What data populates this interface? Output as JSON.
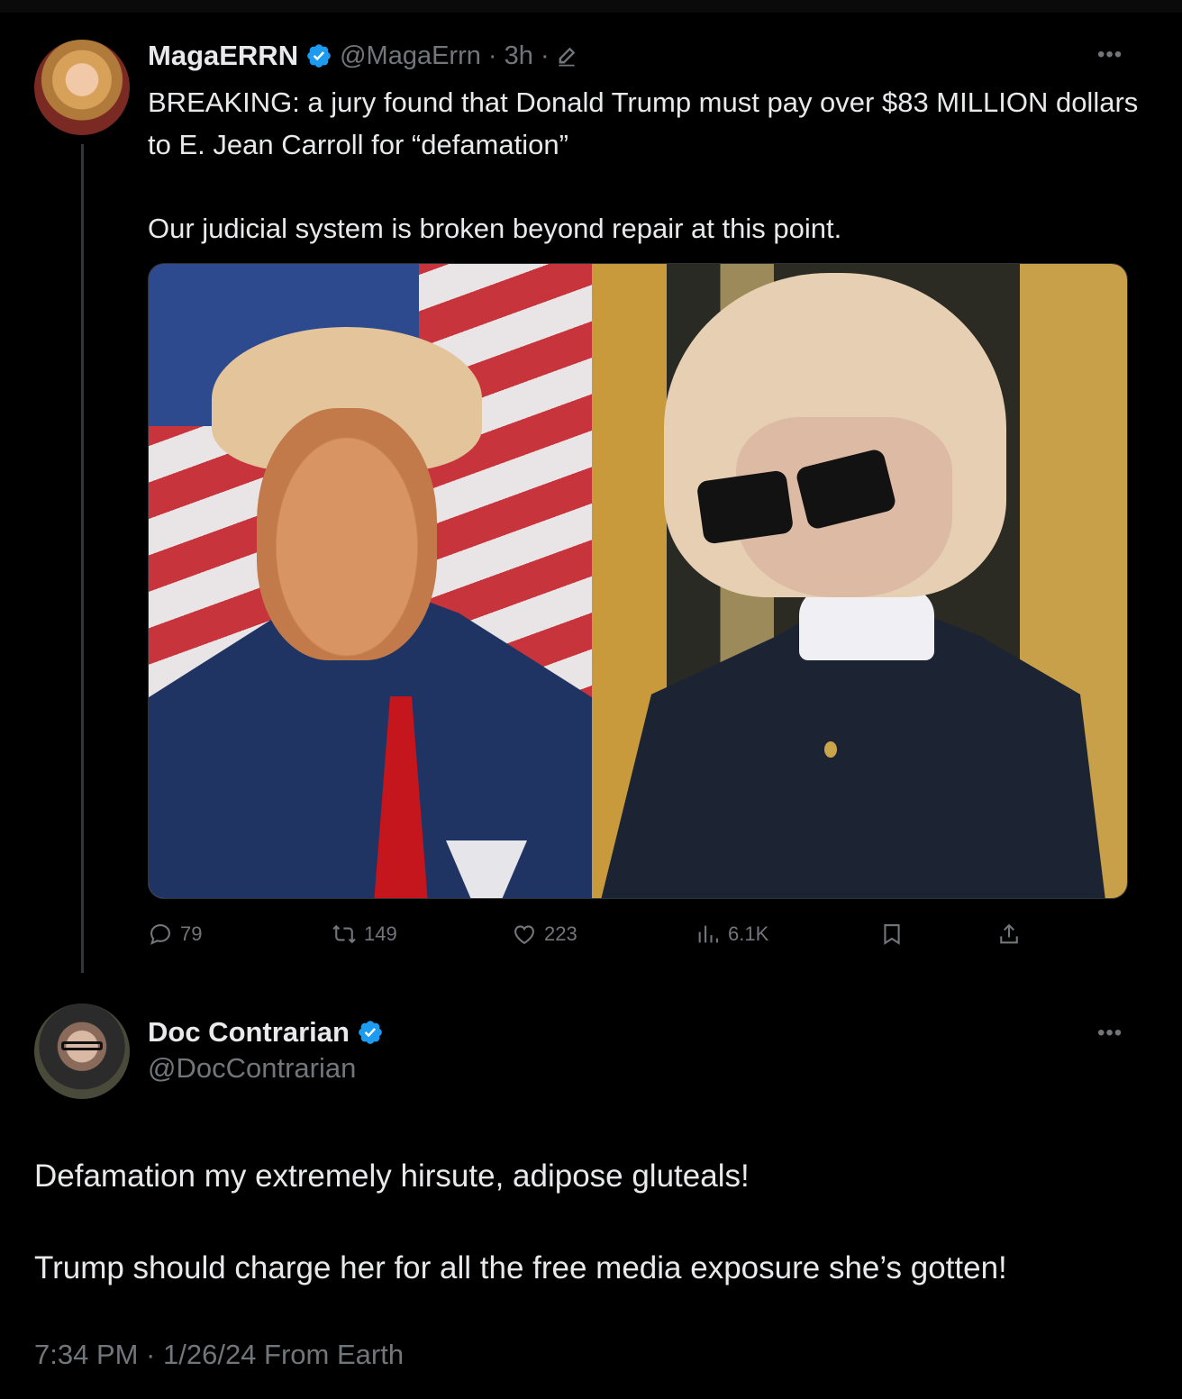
{
  "colors": {
    "background": "#000000",
    "text_primary": "#e7e9ea",
    "text_secondary": "#71767b",
    "verified_blue": "#1d9bf0"
  },
  "tweet": {
    "author": {
      "display_name": "MagaERRN",
      "handle_meta": "@MagaErrn · 3h ·",
      "avatar_icon": "user-avatar",
      "verified_icon": "verified-badge-icon"
    },
    "text_lines": [
      "BREAKING: a jury found that Donald Trump must pay over $83 MILLION dollars to E. Jean Carroll for “defamation”",
      "Our judicial system is broken beyond repair at this point."
    ],
    "media": {
      "left_photo_icon": "photo-man-in-suit",
      "right_photo_icon": "photo-woman-in-sunglasses"
    },
    "actions": {
      "replies": "79",
      "reposts": "149",
      "likes": "223",
      "views": "6.1K"
    }
  },
  "reply": {
    "author": {
      "display_name": "Doc Contrarian",
      "handle": "@DocContrarian",
      "avatar_icon": "user-avatar",
      "verified_icon": "verified-badge-icon"
    },
    "text_lines": [
      "Defamation my extremely hirsute, adipose gluteals!",
      "Trump should charge her for all the free media exposure she’s gotten!"
    ],
    "timestamp": "7:34 PM · 1/26/24 From Earth"
  }
}
